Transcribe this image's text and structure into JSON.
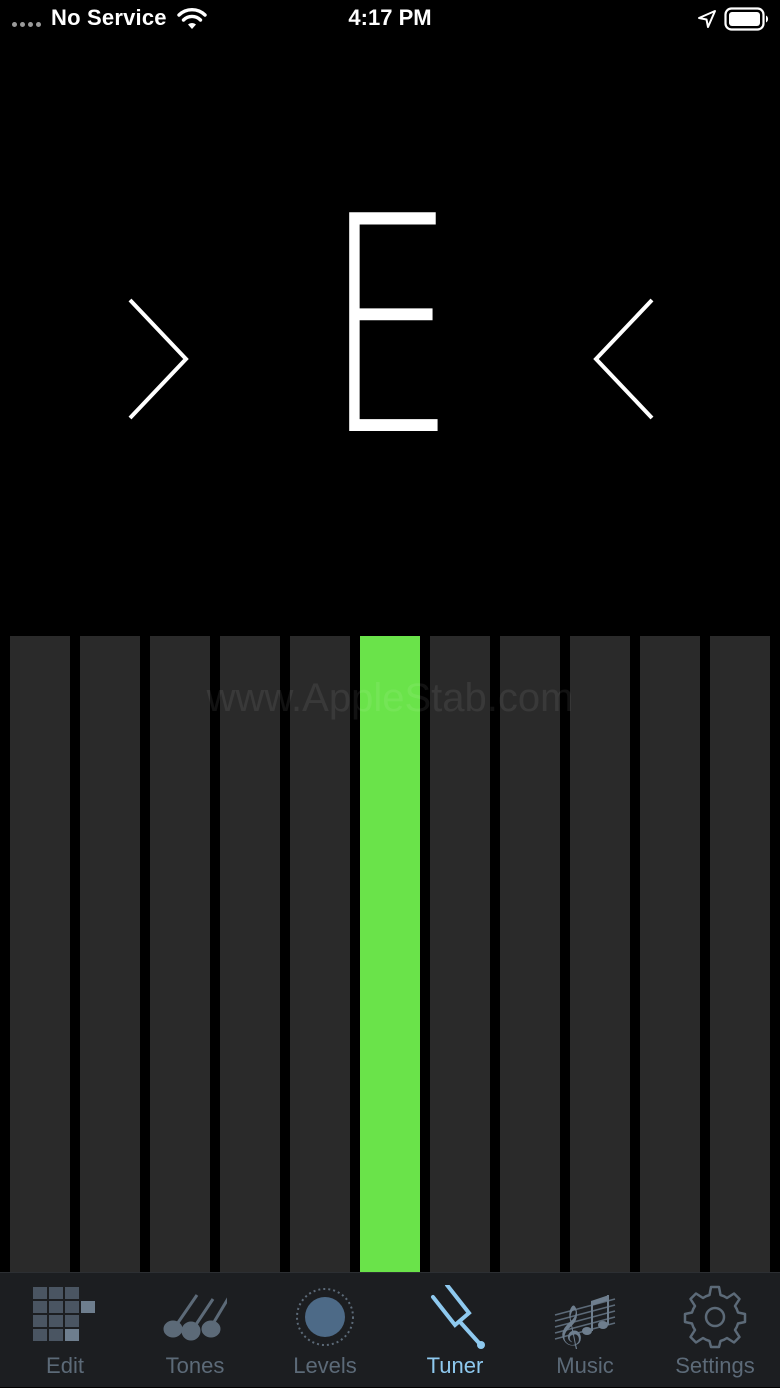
{
  "status_bar": {
    "carrier": "No Service",
    "time": "4:17 PM"
  },
  "tuner": {
    "note": "E",
    "meter": {
      "bar_count": 11,
      "active_bar_index": 5,
      "watermark": "www.AppleStab.com",
      "active_color": "#6ae34a",
      "inactive_color": "#2a2a2a"
    }
  },
  "tab_bar": {
    "active_color": "#8ec9ef",
    "inactive_color": "#5c6a78",
    "tabs": [
      {
        "label": "Edit",
        "icon": "edit-icon",
        "active": false
      },
      {
        "label": "Tones",
        "icon": "guitars-icon",
        "active": false
      },
      {
        "label": "Levels",
        "icon": "levels-knob-icon",
        "active": false
      },
      {
        "label": "Tuner",
        "icon": "tuning-fork-icon",
        "active": true
      },
      {
        "label": "Music",
        "icon": "music-notes-icon",
        "active": false
      },
      {
        "label": "Settings",
        "icon": "gear-icon",
        "active": false
      }
    ]
  }
}
